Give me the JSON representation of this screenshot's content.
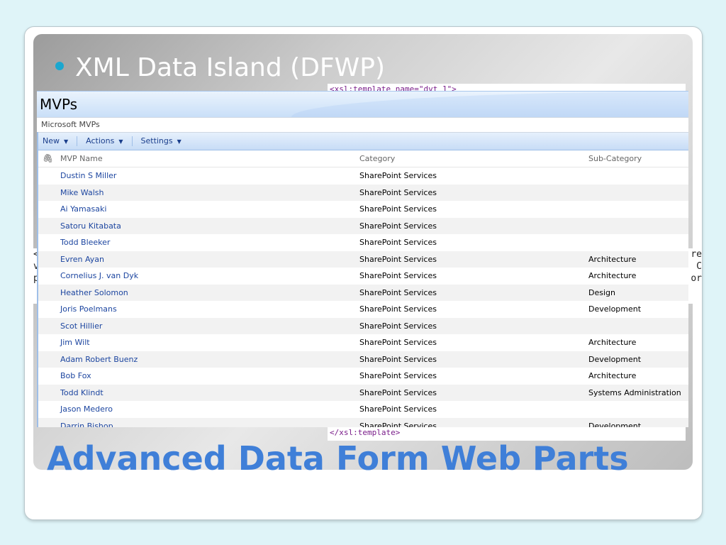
{
  "slide": {
    "bullet": "XML Data Island (DFWP)",
    "title": "Advanced Data Form Web Parts",
    "accent_color": "#1ba7cf",
    "title_color": "#3f7fd8"
  },
  "code": {
    "open_tag": "<xsl:template name=\"dvt_1\">",
    "close_tag": "</xsl:template>"
  },
  "side_fragments": {
    "left": [
      "<",
      "v",
      "p"
    ],
    "right": [
      "re",
      "C",
      "or"
    ]
  },
  "list": {
    "title": "MVPs",
    "description": "Microsoft MVPs",
    "toolbar": {
      "new": "New",
      "actions": "Actions",
      "settings": "Settings"
    },
    "columns": {
      "attachment": "attachment-icon",
      "name": "MVP Name",
      "category": "Category",
      "subcategory": "Sub-Category"
    },
    "rows": [
      {
        "name": "Dustin S Miller",
        "category": "SharePoint Services",
        "subcategory": ""
      },
      {
        "name": "Mike Walsh",
        "category": "SharePoint Services",
        "subcategory": ""
      },
      {
        "name": "Ai Yamasaki",
        "category": "SharePoint Services",
        "subcategory": ""
      },
      {
        "name": "Satoru Kitabata",
        "category": "SharePoint Services",
        "subcategory": ""
      },
      {
        "name": "Todd Bleeker",
        "category": "SharePoint Services",
        "subcategory": ""
      },
      {
        "name": "Evren Ayan",
        "category": "SharePoint Services",
        "subcategory": "Architecture"
      },
      {
        "name": "Cornelius J. van Dyk",
        "category": "SharePoint Services",
        "subcategory": "Architecture"
      },
      {
        "name": "Heather Solomon",
        "category": "SharePoint Services",
        "subcategory": "Design"
      },
      {
        "name": "Joris Poelmans",
        "category": "SharePoint Services",
        "subcategory": "Development"
      },
      {
        "name": "Scot Hillier",
        "category": "SharePoint Services",
        "subcategory": ""
      },
      {
        "name": "Jim Wilt",
        "category": "SharePoint Services",
        "subcategory": "Architecture"
      },
      {
        "name": "Adam Robert Buenz",
        "category": "SharePoint Services",
        "subcategory": "Development"
      },
      {
        "name": "Bob Fox",
        "category": "SharePoint Services",
        "subcategory": "Architecture"
      },
      {
        "name": "Todd Klindt",
        "category": "SharePoint Services",
        "subcategory": "Systems Administration"
      },
      {
        "name": "Jason Medero",
        "category": "SharePoint Services",
        "subcategory": ""
      },
      {
        "name": "Darrin Bishop",
        "category": "SharePoint Services",
        "subcategory": "Development"
      }
    ]
  }
}
